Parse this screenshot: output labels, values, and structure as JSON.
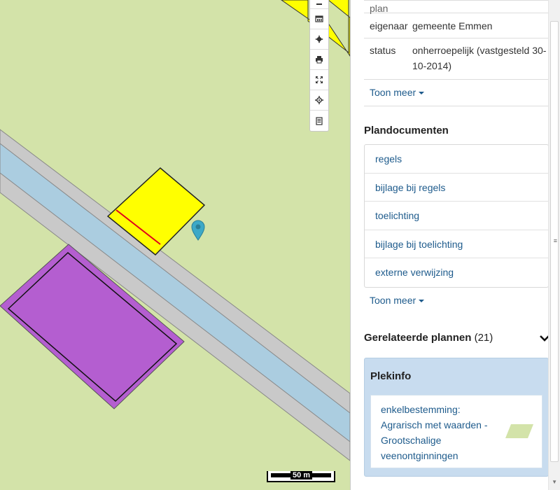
{
  "map": {
    "toolbar_buttons": [
      {
        "icon": "minus-icon"
      },
      {
        "icon": "legend-icon"
      },
      {
        "icon": "settings-icon"
      },
      {
        "icon": "print-icon"
      },
      {
        "icon": "fullscreen-icon"
      },
      {
        "icon": "locate-icon"
      },
      {
        "icon": "document-icon"
      }
    ],
    "scale_label": "50 m",
    "colors": {
      "background": "#d3e3a9",
      "road": "#c9c9c9",
      "water": "#abcde0",
      "yellow_zone": "#ffff00",
      "purple_zone": "#b45ed0",
      "marker": "#3da9c7"
    }
  },
  "panel": {
    "info_rows": [
      {
        "key": "plan",
        "value": ""
      },
      {
        "key": "eigenaar",
        "value": "gemeente Emmen"
      },
      {
        "key": "status",
        "value": "onherroepelijk (vastgesteld 30-10-2014)"
      }
    ],
    "toon_meer_1": "Toon meer",
    "plandocumenten": {
      "title": "Plandocumenten",
      "items": [
        "regels",
        "bijlage bij regels",
        "toelichting",
        "bijlage bij toelichting",
        "externe verwijzing"
      ],
      "toon_meer": "Toon meer"
    },
    "related": {
      "title": "Gerelateerde plannen",
      "count": "(21)"
    },
    "plekinfo": {
      "title": "Plekinfo",
      "item": "enkelbestemming: Agrarisch met waarden - Grootschalige veenontginningen",
      "swatch_color": "#d3e3a9"
    }
  }
}
